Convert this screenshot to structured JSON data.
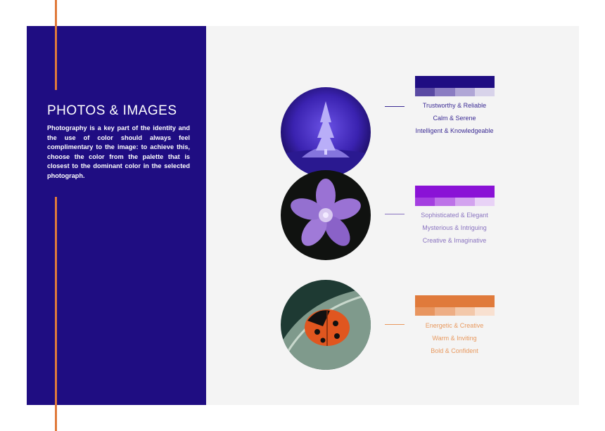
{
  "section": {
    "title": "PHOTOS & IMAGES",
    "body": "Photography is a key part of the identity and the use of color should always feel complimentary to the image: to achieve this, choose the color from the palette that is closest to the dominant color in the selected photograph."
  },
  "colors": {
    "left_panel": "#1f0d82",
    "right_panel": "#f4f4f4",
    "accent": "#e07a3b"
  },
  "examples": [
    {
      "photo_icon": "tree-photo-icon",
      "palette_main": "#1f0d82",
      "palette_tints": [
        "#5a4aa3",
        "#8a7cc2",
        "#b0a6d6",
        "#d8d3ea"
      ],
      "text_color": "#3b2b94",
      "traits": [
        "Trustworthy & Reliable",
        "Calm & Serene",
        "Intelligent & Knowledgeable"
      ]
    },
    {
      "photo_icon": "flower-photo-icon",
      "palette_main": "#8a12d6",
      "palette_tints": [
        "#a43fe0",
        "#bd72e8",
        "#d3a3ef",
        "#e8d2f6"
      ],
      "text_color": "#8a74c0",
      "traits": [
        "Sophisticated & Elegant",
        "Mysterious & Intriguing",
        "Creative & Imaginative"
      ]
    },
    {
      "photo_icon": "ladybug-photo-icon",
      "palette_main": "#e07a3b",
      "palette_tints": [
        "#e8955f",
        "#eeae85",
        "#f3c8aa",
        "#f8e0d0"
      ],
      "text_color": "#e8995f",
      "traits": [
        "Energetic & Creative",
        "Warm & Inviting",
        "Bold & Confident"
      ]
    }
  ]
}
